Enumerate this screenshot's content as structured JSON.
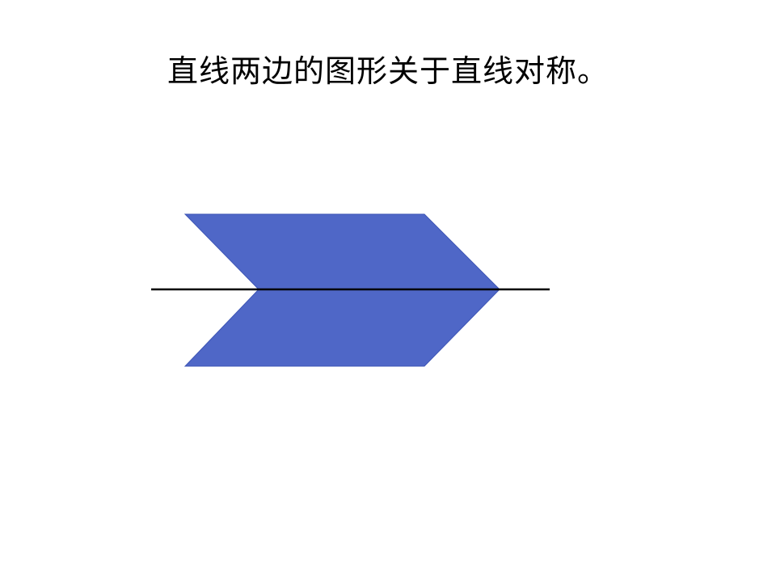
{
  "caption": "直线两边的图形关于直线对称。",
  "colors": {
    "shape_fill": "#4F67C7",
    "shape_stroke": "#3D55B5",
    "axis_line": "#000000",
    "background": "#FFFFFF"
  }
}
